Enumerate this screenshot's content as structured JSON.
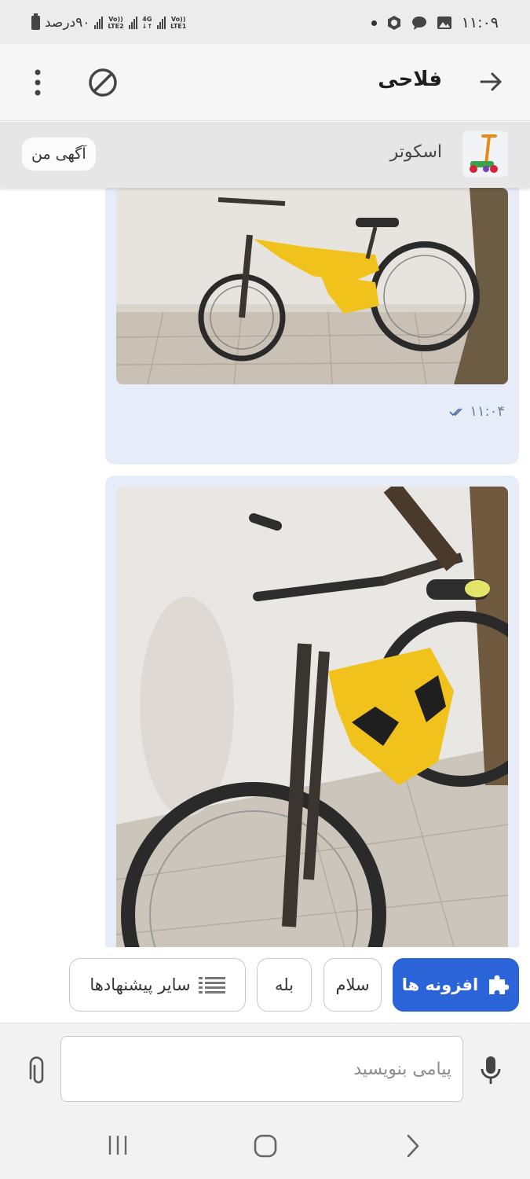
{
  "status_bar": {
    "battery_text": "۹۰درصد",
    "net1": "Vo))\nLTE2",
    "net2": "4G\n↓↑",
    "net3": "Vo))\nLTE1",
    "time": "۱۱:۰۹"
  },
  "header": {
    "title": "فلاحی"
  },
  "ad": {
    "title": "اسکوتر",
    "my_ad_label": "آگهی من"
  },
  "messages": [
    {
      "type": "image",
      "subject": "yellow mountain bike",
      "time": "۱۱:۰۴",
      "status": "read"
    },
    {
      "type": "image",
      "subject": "yellow mountain bike close-up"
    }
  ],
  "suggestions": {
    "addons_label": "افزونه ها",
    "items": [
      "سلام",
      "بله"
    ],
    "more_label": "سایر پیشنهادها"
  },
  "composer": {
    "placeholder": "پیامی بنویسید"
  },
  "colors": {
    "accent": "#2b63d9",
    "bubble": "#e6edf9",
    "bike_yellow": "#f1c21b"
  }
}
